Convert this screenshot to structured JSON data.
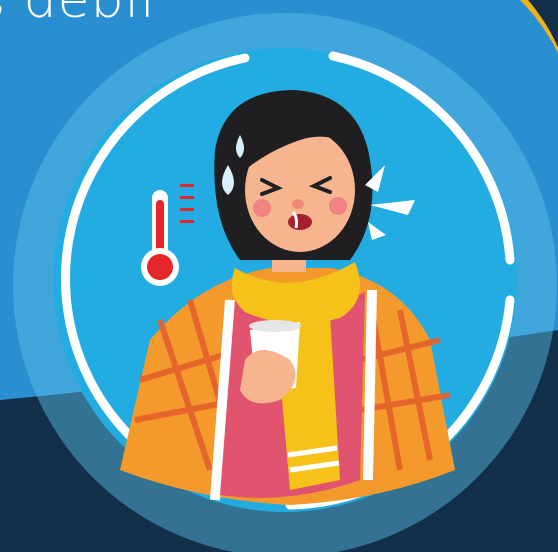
{
  "headline": {
    "text": "s débil"
  },
  "colors": {
    "background": "#2a8fd0",
    "dark_band": "#13304a",
    "circle_fill": "#25ade2",
    "ring": "#ffffff",
    "accent_gold": "#f2b21c",
    "thermometer_red": "#e5262a",
    "scarf_yellow": "#f6c21a",
    "jacket_orange": "#f49a2c",
    "shirt_pink": "#e0546f",
    "hair": "#1f1f22",
    "skin": "#f6b48f"
  },
  "illustration": {
    "subject": "sick-woman-with-cold",
    "icons": [
      "thermometer-icon",
      "sweat-drop-icon",
      "sneeze-burst-icon"
    ]
  }
}
